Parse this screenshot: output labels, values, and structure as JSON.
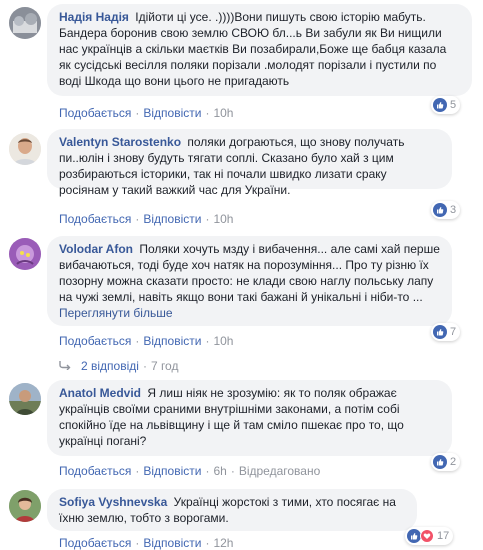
{
  "comments": [
    {
      "author": "Надія Надія",
      "text": "Ідійоти ці усе. .))))Вони пишуть свою історію мабуть. Бандера боронив свою землю СВОЮ бл...ь Ви забули як Ви нищили нас українців а скільки маєтків Ви позабирали,Боже ще бабця казала як сусідські весілля поляки порізали .молодят порізали і пустили по воді Шкода що вони цього не пригадають",
      "actions": {
        "like": "Подобається",
        "reply": "Відповісти",
        "time": "10h"
      },
      "reaction_count": "5"
    },
    {
      "author": "Valentyn Starostenko",
      "text": "поляки дограються, що знову получать пи..юлін і знову будуть тягати соплі. Сказано було хай з цим розбираються історики, так ні почали швидко лизати сраку росіянам у такий важкий час для України.",
      "actions": {
        "like": "Подобається",
        "reply": "Відповісти",
        "time": "10h"
      },
      "reaction_count": "3"
    },
    {
      "author": "Volodar Afon",
      "text": "Поляки хочуть мзду і вибачення... але самі хай перше вибачаються, тоді буде хоч натяк на порозуміння... Про ту різню їх позорну можна сказати просто: не клади свою наглу польську лапу на чужі землі, навіть якщо вони такі бажані й унікальні і ніби-то ...",
      "see_more": "Переглянути більше",
      "actions": {
        "like": "Подобається",
        "reply": "Відповісти",
        "time": "10h"
      },
      "reaction_count": "7",
      "replies": {
        "label": "2 відповіді",
        "time": "7 год"
      }
    },
    {
      "author": "Anatol Medvid",
      "text": "Я лиш ніяк не зрозумію: як то поляк ображає українців своїми сраними внутрішніми законами, а потім собі спокійно їде на львівщину і ще й там сміло пшекає про то, що українці погані?",
      "actions": {
        "like": "Подобається",
        "reply": "Відповісти",
        "time": "6h",
        "edited": "Відредаговано"
      },
      "reaction_count": "2"
    },
    {
      "author": "Sofiya Vyshnevska",
      "text": "Українці жорстокі з тими, хто посягає на їхню землю, тобто з ворогами.",
      "actions": {
        "like": "Подобається",
        "reply": "Відповісти",
        "time": "12h"
      },
      "reaction_count": "17"
    }
  ],
  "colors": {
    "link": "#385898",
    "action": "#4267b2",
    "meta": "#90949c",
    "bubble": "#f2f3f5",
    "like": "#4267b2",
    "love": "#f25268"
  },
  "icons": [
    "like-icon",
    "love-icon",
    "reply-arrow-icon"
  ]
}
